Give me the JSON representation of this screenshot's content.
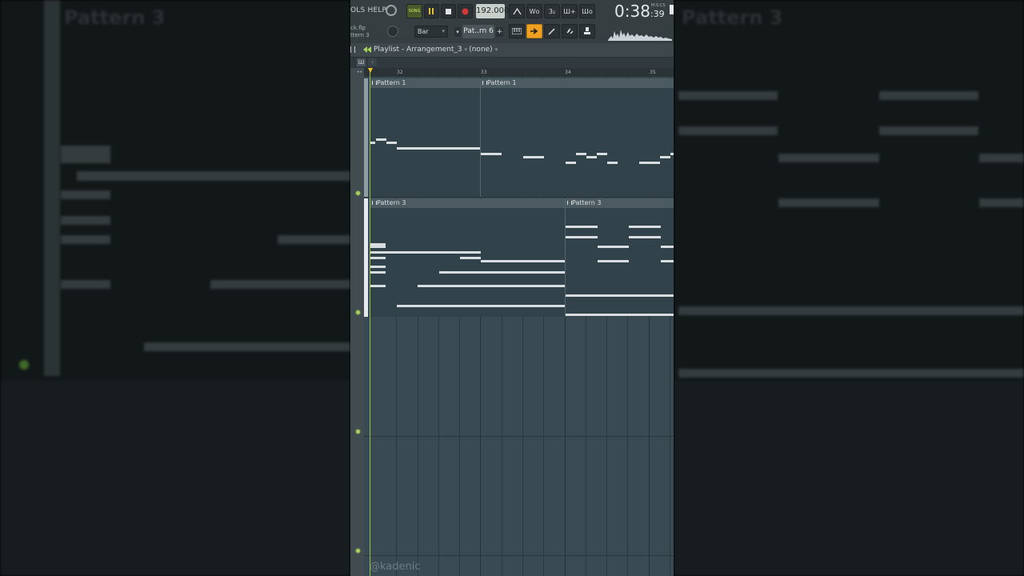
{
  "background": {
    "left_title": "Pattern 3",
    "right_title": "Pattern 3"
  },
  "toolbar": {
    "menu": "OLS  HELP",
    "mode_label": "SONG",
    "tempo": "192.000",
    "clock_main": "0:38",
    "clock_sub": ":39",
    "clock_unit": "M:S:CS",
    "file_line1": "ck.flp",
    "file_line2": "ttern 3",
    "snap": "Bar",
    "pattern": "Pat..rn 6",
    "icons": [
      "metronome-icon",
      "countdown-icon",
      "wait-icon",
      "step-edit-icon",
      "blend-icon",
      "typing-keyboard-icon",
      "arrow-icon",
      "brush-icon",
      "link-icon",
      "stamp-icon"
    ]
  },
  "playlist": {
    "title": "Playlist - Arrangement_3",
    "selection": "(none)",
    "ruler": [
      "32",
      "33",
      "34",
      "35"
    ]
  },
  "clips": {
    "pattern1_a": "Pattern 1",
    "pattern1_b": "Pattern 1",
    "pattern3_a": "Pattern 3",
    "pattern3_b": "Pattern 3"
  },
  "watermark": "@kadenic",
  "colors": {
    "accent_green": "#a6d25a",
    "record_red": "#d23a3a",
    "active_orange": "#f0a020",
    "clip_bg": "#31424a"
  }
}
